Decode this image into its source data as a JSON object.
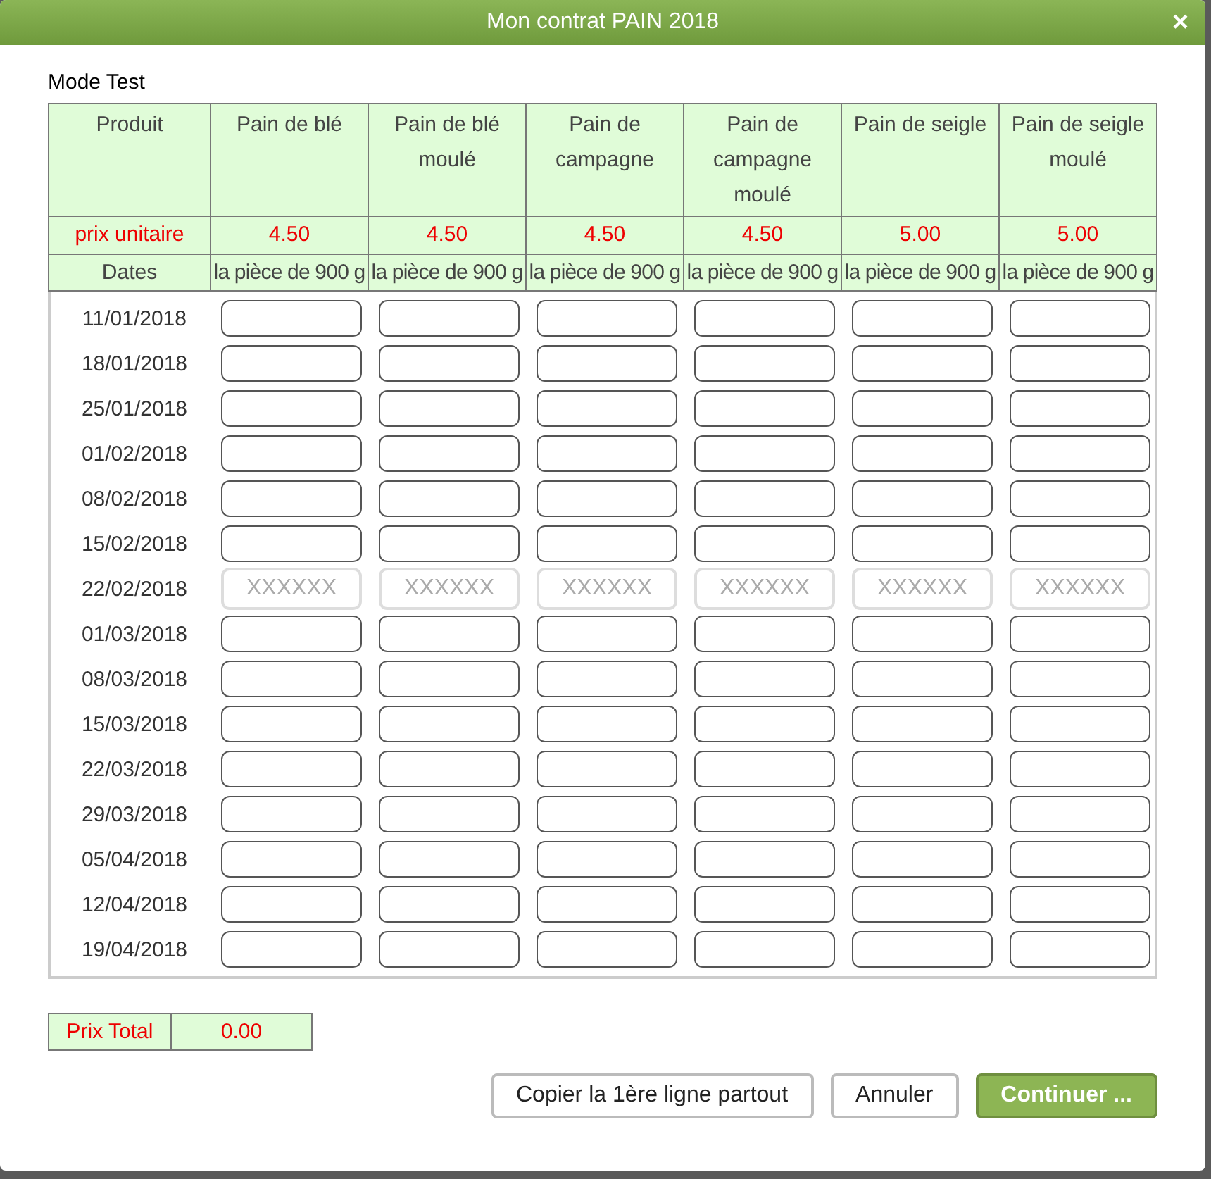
{
  "window": {
    "title": "Mon contrat PAIN 2018",
    "close": "×"
  },
  "mode": "Mode Test",
  "header": {
    "product_label": "Produit",
    "price_label": "prix unitaire",
    "dates_label": "Dates"
  },
  "columns": [
    {
      "name": "Pain de blé",
      "price": "4.50",
      "unit": "la pièce de 900 g"
    },
    {
      "name": "Pain de blé moulé",
      "price": "4.50",
      "unit": "la pièce de 900 g"
    },
    {
      "name": "Pain de campagne",
      "price": "4.50",
      "unit": "la pièce de 900 g"
    },
    {
      "name": "Pain de campagne moulé",
      "price": "4.50",
      "unit": "la pièce de 900 g"
    },
    {
      "name": "Pain de seigle",
      "price": "5.00",
      "unit": "la pièce de 900 g"
    },
    {
      "name": "Pain de seigle moulé",
      "price": "5.00",
      "unit": "la pièce de 900 g"
    }
  ],
  "rows": [
    {
      "date": "11/01/2018",
      "disabled": false
    },
    {
      "date": "18/01/2018",
      "disabled": false
    },
    {
      "date": "25/01/2018",
      "disabled": false
    },
    {
      "date": "01/02/2018",
      "disabled": false
    },
    {
      "date": "08/02/2018",
      "disabled": false
    },
    {
      "date": "15/02/2018",
      "disabled": false
    },
    {
      "date": "22/02/2018",
      "disabled": true,
      "placeholders": [
        "XXXXXX",
        "XXXXXX",
        "XXXXXX",
        "XXXXXX",
        "XXXXXX",
        "XXXXXX"
      ]
    },
    {
      "date": "01/03/2018",
      "disabled": false
    },
    {
      "date": "08/03/2018",
      "disabled": false
    },
    {
      "date": "15/03/2018",
      "disabled": false
    },
    {
      "date": "22/03/2018",
      "disabled": false
    },
    {
      "date": "29/03/2018",
      "disabled": false
    },
    {
      "date": "05/04/2018",
      "disabled": false
    },
    {
      "date": "12/04/2018",
      "disabled": false
    },
    {
      "date": "19/04/2018",
      "disabled": false
    }
  ],
  "total": {
    "label": "Prix Total",
    "value": "0.00"
  },
  "buttons": [
    {
      "label": "Copier la 1ère ligne partout",
      "kind": "secondary"
    },
    {
      "label": "Annuler",
      "kind": "secondary"
    },
    {
      "label": "Continuer ...",
      "kind": "primary"
    }
  ]
}
